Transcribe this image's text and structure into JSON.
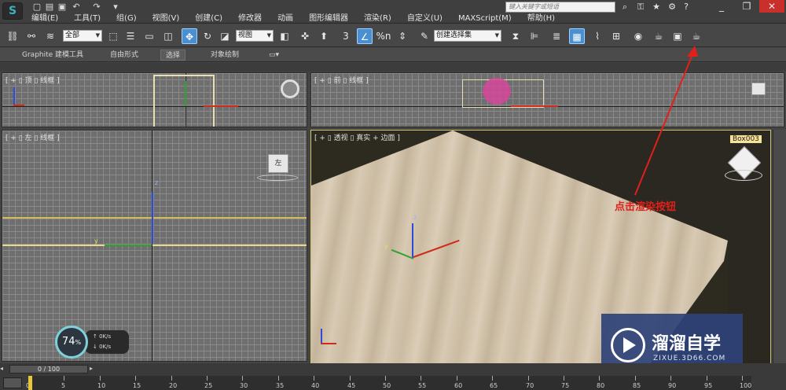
{
  "app": {
    "logo_text": "S",
    "search_placeholder": "键入关键字或短语",
    "menu": [
      "编辑(E)",
      "工具(T)",
      "组(G)",
      "视图(V)",
      "创建(C)",
      "修改器",
      "动画",
      "图形编辑器",
      "渲染(R)",
      "自定义(U)",
      "MAXScript(M)",
      "帮助(H)"
    ],
    "window_buttons": {
      "minimize": "_",
      "restore": "❐",
      "close": "✕"
    }
  },
  "toolbar": {
    "selection_filter": "全部",
    "reference_coord": "视图",
    "named_selection": "创建选择集",
    "snap_label": "3",
    "percent_snap_label": "%n"
  },
  "ribbon": {
    "tabs": [
      "Graphite 建模工具",
      "自由形式",
      "选择",
      "对象绘制"
    ],
    "active_tab": "选择"
  },
  "viewports": {
    "top": {
      "label": "[ + ▯ 顶 ▯ 线框 ]"
    },
    "front": {
      "label": "[ + ▯ 前 ▯ 线框 ]"
    },
    "left": {
      "label": "[ + ▯ 左 ▯ 线框 ]"
    },
    "perspective": {
      "label": "[ + ▯ 透视 ▯ 真实 + 边面 ]",
      "object_label": "Box003"
    }
  },
  "viewcube_labels": {
    "left": "左"
  },
  "axis_labels": {
    "x": "x",
    "y": "y",
    "z": "z"
  },
  "annotation": {
    "text": "点击渲染按钮",
    "color": "#e0201a"
  },
  "watermark": {
    "title": "溜溜自学",
    "url": "ZIXUE.3D66.COM"
  },
  "performance": {
    "percent": "74",
    "percent_unit": "%",
    "up_rate": "0K/s",
    "down_rate": "0K/s"
  },
  "timeline": {
    "frame_display": "0 / 100",
    "ticks": [
      "0",
      "5",
      "10",
      "15",
      "20",
      "25",
      "30",
      "35",
      "40",
      "45",
      "50",
      "55",
      "60",
      "65",
      "70",
      "75",
      "80",
      "85",
      "90",
      "95",
      "100"
    ]
  },
  "colors": {
    "active_tool": "#4a8fd0",
    "frame_highlight": "#d5c36a",
    "annotation": "#e0201a"
  }
}
